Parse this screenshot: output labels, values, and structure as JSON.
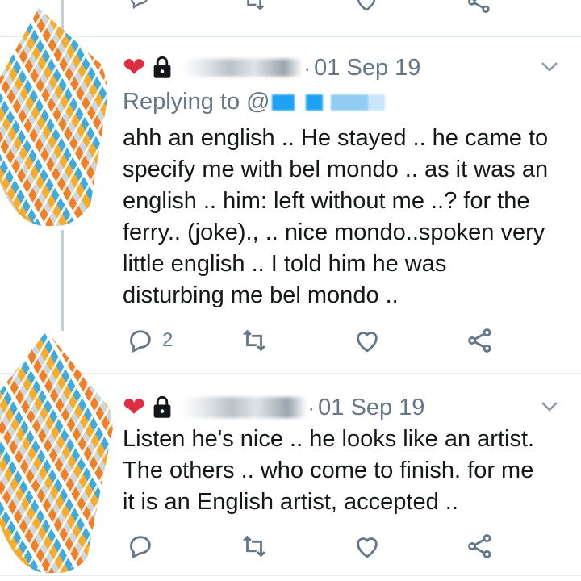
{
  "tweets": [
    {
      "date": "01 Sep 19",
      "replying_label": "Replying to @",
      "text": "ahh an english .. He stayed .. he came to\nspecify me with bel mondo .. as it was an\nenglish .. him:  left without me ..? for the\nferry.. (joke)., .. nice mondo..spoken very\nlittle english .. I told him he was\ndisturbing me bel mondo ..",
      "reply_count": "2",
      "icons": [
        "heart-emoji",
        "lock-icon",
        "chevron-down-icon",
        "reply-icon",
        "retweet-icon",
        "like-icon",
        "share-icon"
      ]
    },
    {
      "date": "01 Sep 19",
      "text": "Listen he's nice .. he looks like an artist.\nThe others .. who come to finish. for me\nit is an English artist, accepted ..",
      "icons": [
        "heart-emoji",
        "lock-icon",
        "chevron-down-icon",
        "reply-icon",
        "retweet-icon",
        "like-icon",
        "share-icon"
      ]
    }
  ],
  "colors": {
    "text": "#14171a",
    "muted": "#657786",
    "link": "#1da1f2",
    "heart": "#dd2e44",
    "divider": "#e6ecf0"
  },
  "glyphs": {
    "heart": "❤",
    "chevron": "﹀"
  }
}
